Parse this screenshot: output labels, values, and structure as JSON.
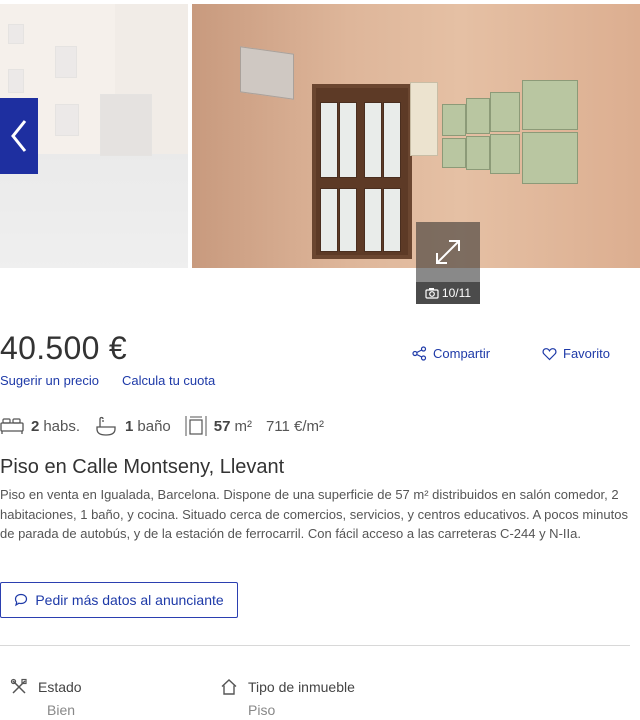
{
  "gallery": {
    "counter": "10/11",
    "icons": {
      "prev": "chevron-left-icon",
      "expand": "expand-arrows-icon",
      "camera": "camera-icon"
    }
  },
  "listing": {
    "price": "40.500 €",
    "links": {
      "suggest_price": "Sugerir un precio",
      "calculate_fee": "Calcula tu cuota"
    },
    "actions": {
      "share": "Compartir",
      "favorite": "Favorito"
    },
    "features": {
      "rooms_value": "2",
      "rooms_unit": "habs.",
      "baths_value": "1",
      "baths_unit": "baño",
      "area_value": "57",
      "area_unit": "m²",
      "price_per_m2": "711 €/m²"
    },
    "title": "Piso en Calle Montseny, Llevant",
    "description": "Piso en venta en Igualada, Barcelona. Dispone de una superficie de 57 m² distribuidos en salón comedor, 2 habitaciones, 1 baño, y cocina. Situado cerca de comercios, servicios, y centros educativos. A pocos minutos de parada de autobús, y de la estación de ferrocarril. Con fácil acceso a las carreteras C-244 y N-IIa.",
    "contact_button": "Pedir más datos al anunciante"
  },
  "specs": [
    {
      "label": "Estado",
      "value": "Bien",
      "icon": "tools-icon"
    },
    {
      "label": "Tipo de inmueble",
      "value": "Piso",
      "icon": "house-icon"
    }
  ],
  "colors": {
    "accent": "#1e3aa8",
    "nav_button": "#1e2fa0",
    "text": "#333333"
  }
}
